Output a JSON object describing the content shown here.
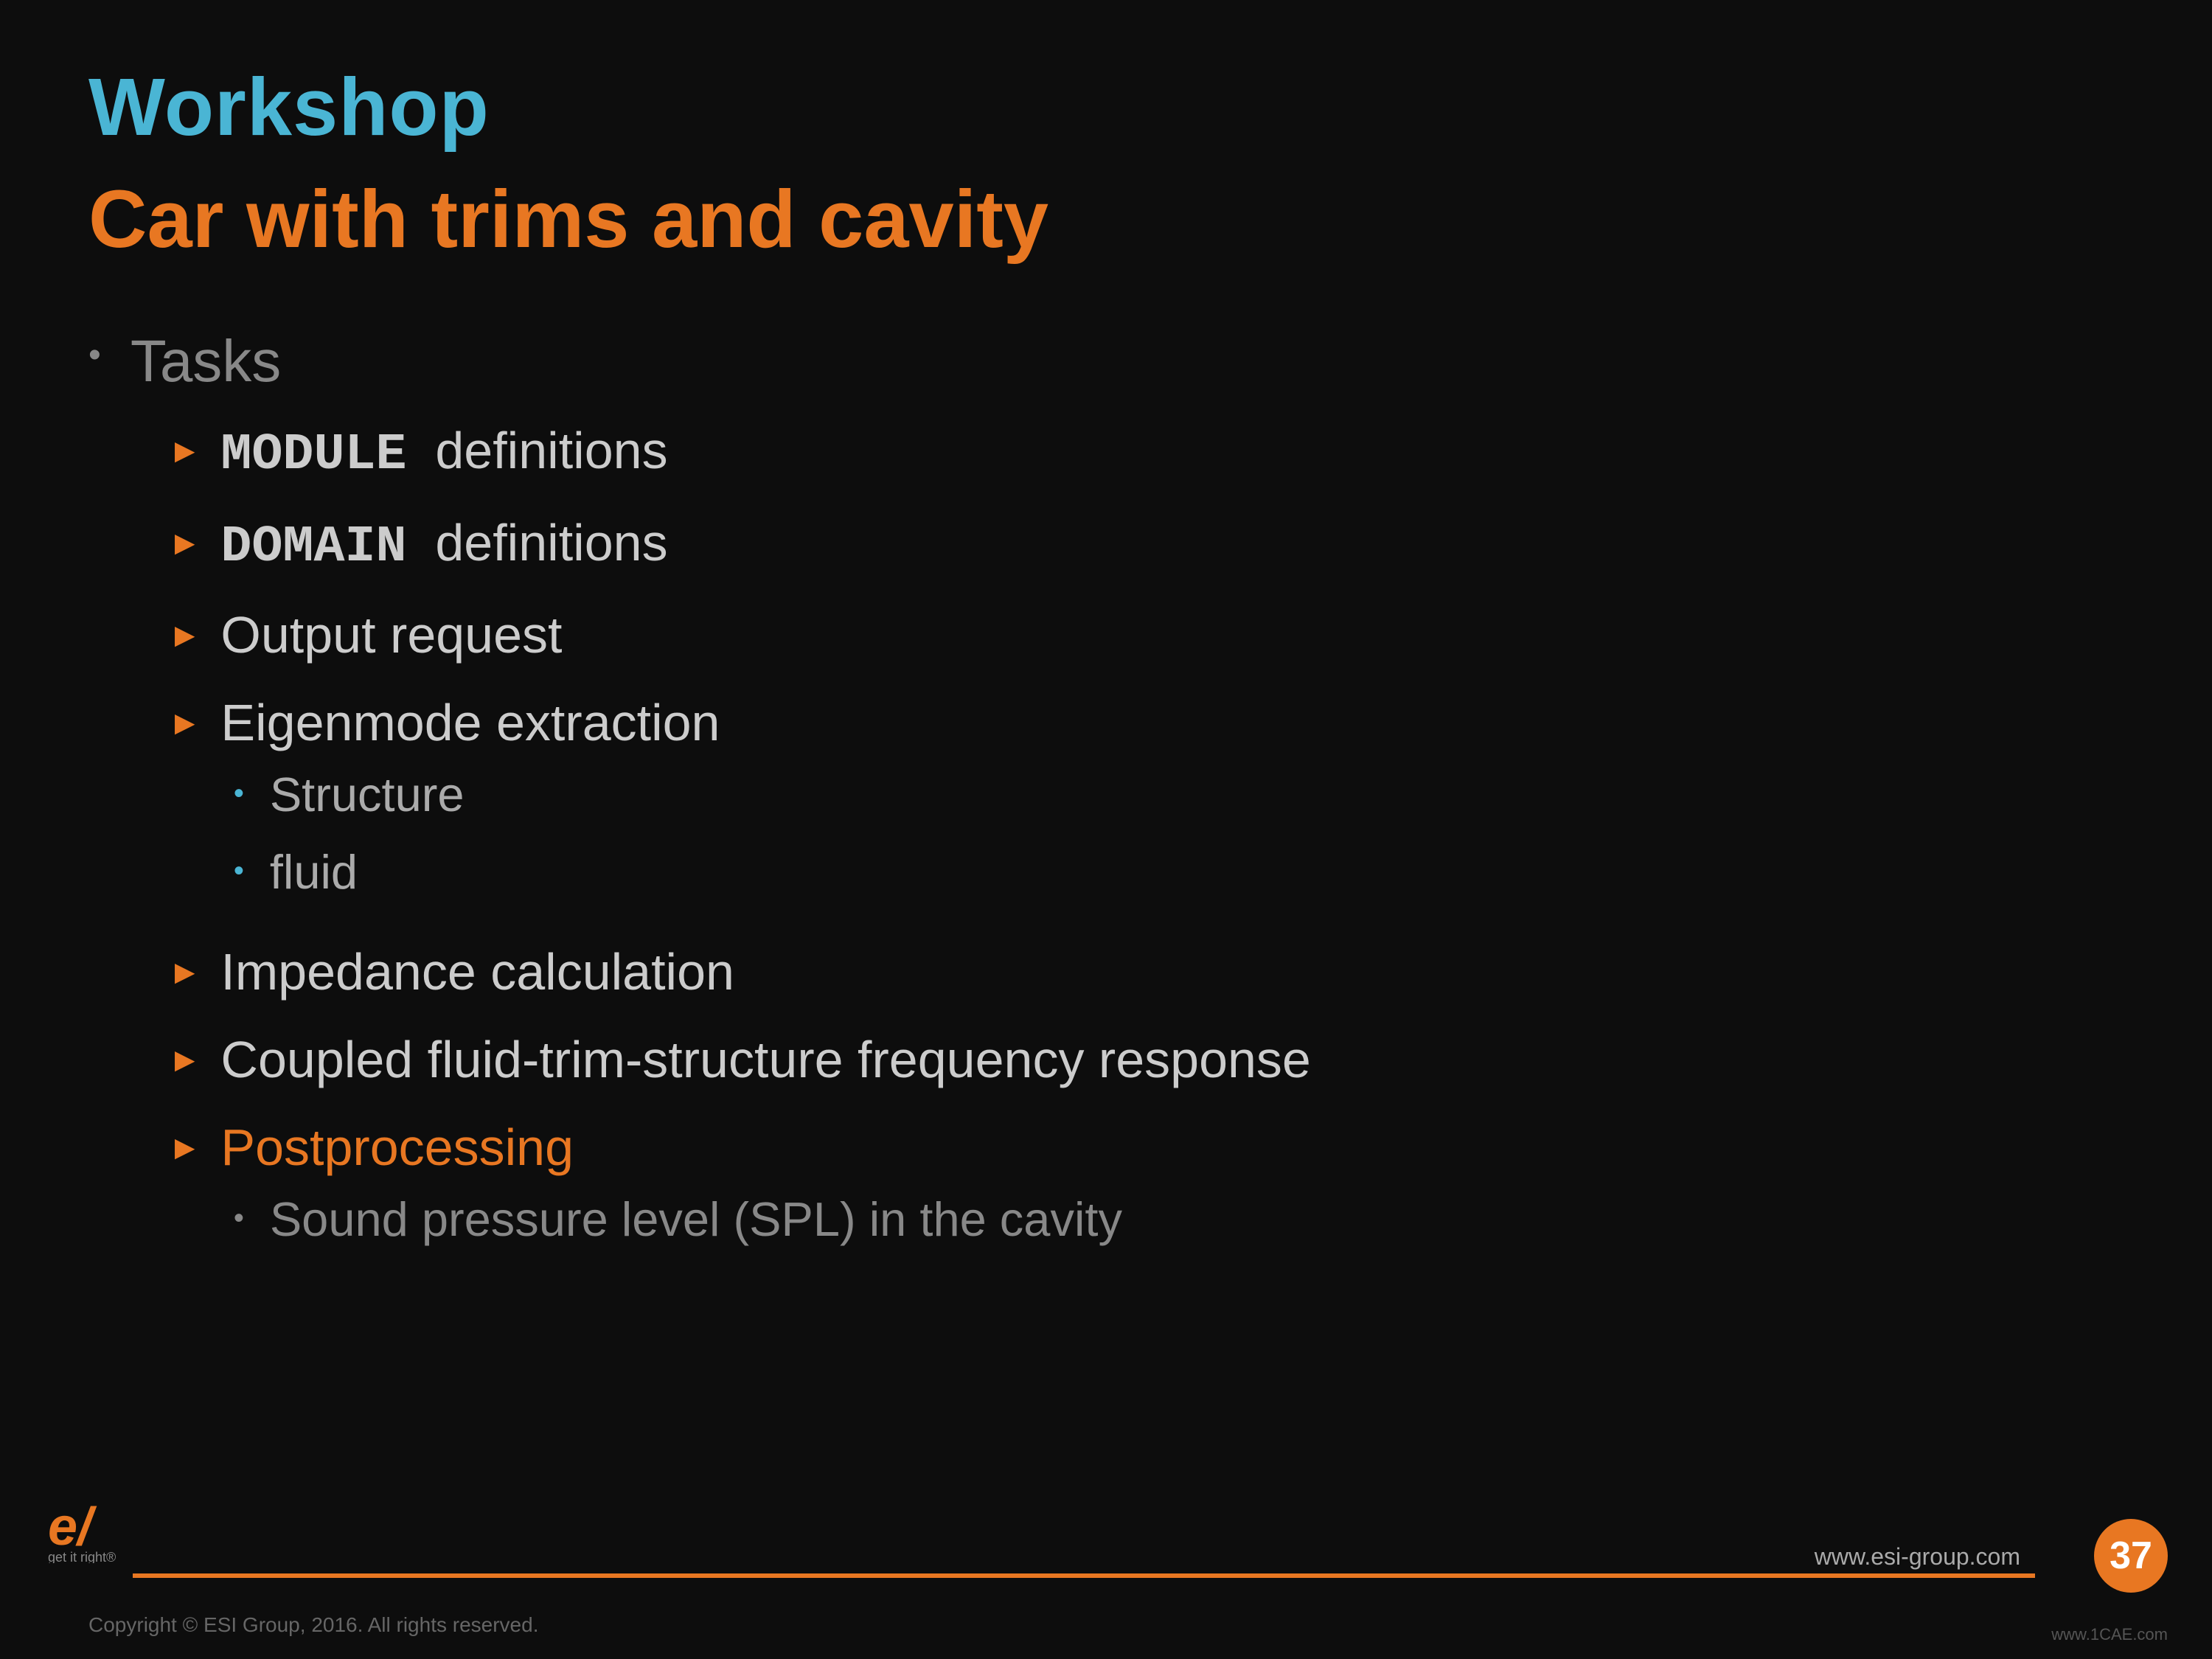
{
  "header": {
    "title": "Workshop",
    "subtitle": "Car with trims and cavity"
  },
  "content": {
    "top_bullet_label": "Tasks",
    "items": [
      {
        "id": "module",
        "prefix_mono": "MODULE",
        "suffix": "  definitions",
        "highlight": false,
        "sub_items": []
      },
      {
        "id": "domain",
        "prefix_mono": "DOMAIN",
        "suffix": "  definitions",
        "highlight": false,
        "sub_items": []
      },
      {
        "id": "output",
        "prefix_mono": "",
        "suffix": "Output request",
        "highlight": false,
        "sub_items": []
      },
      {
        "id": "eigenmode",
        "prefix_mono": "",
        "suffix": "Eigenmode extraction",
        "highlight": false,
        "sub_items": [
          {
            "text": "Structure"
          },
          {
            "text": "fluid"
          }
        ]
      },
      {
        "id": "impedance",
        "prefix_mono": "",
        "suffix": "Impedance calculation",
        "highlight": false,
        "sub_items": []
      },
      {
        "id": "coupled",
        "prefix_mono": "",
        "suffix": "Coupled fluid-trim-structure frequency response",
        "highlight": false,
        "sub_items": []
      },
      {
        "id": "postprocessing",
        "prefix_mono": "",
        "suffix": "Postprocessing",
        "highlight": true,
        "sub_items": [
          {
            "text": "Sound pressure level (SPL) in the cavity"
          }
        ]
      }
    ]
  },
  "footer": {
    "copyright": "Copyright © ESI Group, 2016. All rights reserved.",
    "website": "www.esi-group.com",
    "page_number": "37",
    "logo_text": "e/",
    "logo_tagline": "get it right®",
    "watermark": "www.1CAE.com"
  },
  "colors": {
    "title_blue": "#4ab5d4",
    "accent_orange": "#e87722",
    "text_gray": "#cccccc",
    "dim_gray": "#888888",
    "background": "#0d0d0d"
  }
}
